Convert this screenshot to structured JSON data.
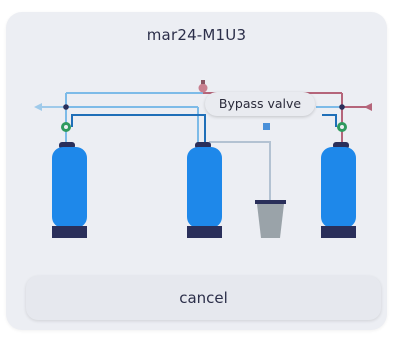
{
  "dialog": {
    "title": "mar24-M1U3",
    "tooltip_label": "Bypass valve",
    "cancel_label": "cancel"
  },
  "colors": {
    "dialog_bg": "#eceef3",
    "tank_blue": "#1e88ea",
    "tank_base": "#2a2f5a",
    "pipe_light": "#7dbbe8",
    "pipe_gray": "#b3c2d2",
    "pipe_red": "#b5657a",
    "valve_green": "#2f9a5e",
    "bucket_gray": "#9aa3a9"
  },
  "icons": [
    "bypass-valve-icon",
    "valve-icon",
    "outlet-arrow-icon",
    "inlet-arrow-icon",
    "drain-bucket-icon"
  ]
}
